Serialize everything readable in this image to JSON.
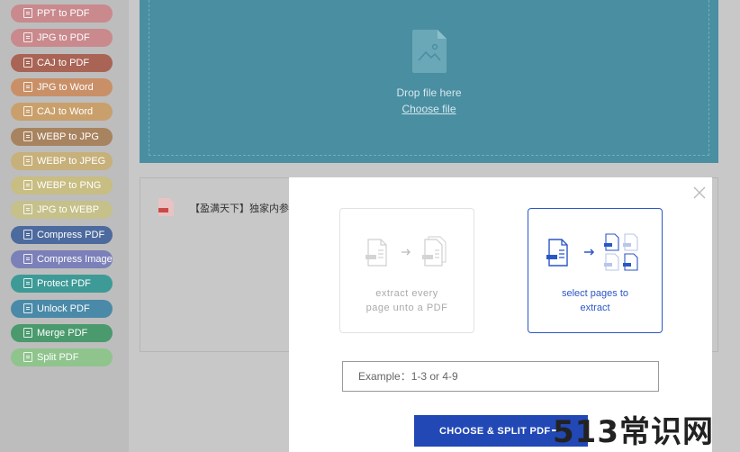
{
  "sidebar": {
    "items": [
      {
        "label": "PPT to PDF",
        "color": "#c9898d"
      },
      {
        "label": "JPG to PDF",
        "color": "#c9898d"
      },
      {
        "label": "CAJ to PDF",
        "color": "#a96455"
      },
      {
        "label": "JPG to Word",
        "color": "#c99067"
      },
      {
        "label": "CAJ to Word",
        "color": "#c9a06b"
      },
      {
        "label": "WEBP to JPG",
        "color": "#a8835f"
      },
      {
        "label": "WEBP to JPEG",
        "color": "#c7b07a"
      },
      {
        "label": "WEBP to PNG",
        "color": "#c8bd82"
      },
      {
        "label": "JPG to WEBP",
        "color": "#c6c08a"
      },
      {
        "label": "Compress PDF",
        "color": "#4d6a9e"
      },
      {
        "label": "Compress Image",
        "color": "#7b80b9"
      },
      {
        "label": "Protect PDF",
        "color": "#3d9a97"
      },
      {
        "label": "Unlock PDF",
        "color": "#4a8aa8"
      },
      {
        "label": "Merge PDF",
        "color": "#4a9a6e"
      },
      {
        "label": "Split PDF",
        "color": "#8fc48c"
      }
    ]
  },
  "dropzone": {
    "drop_text": "Drop file here",
    "choose_label": "Choose file"
  },
  "file": {
    "name": "【盈满天下】独家内参"
  },
  "modal": {
    "option1_line1": "extract every",
    "option1_line2": "page unto a PDF",
    "option2_line1": "select pages to",
    "option2_line2": "extract",
    "input_placeholder": "Example：1-3 or 4-9",
    "button_label": "CHOOSE & SPLIT PDF",
    "accent": "#2b56c6"
  },
  "watermark": {
    "text": "513常识网"
  }
}
